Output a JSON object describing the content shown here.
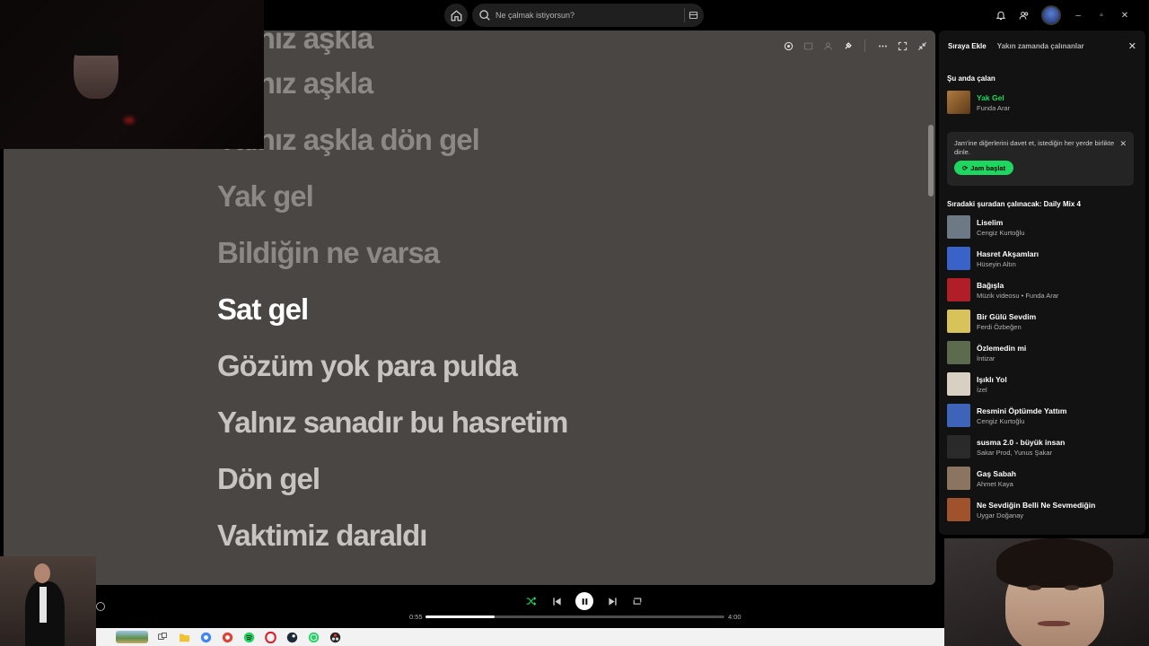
{
  "search": {
    "placeholder": "Ne çalmak istiyorsun?"
  },
  "queue": {
    "tabs": [
      "Sıraya Ekle",
      "Yakın zamanda çalınanlar"
    ],
    "now_playing_heading": "Şu anda çalan",
    "now_playing": {
      "title": "Yak Gel",
      "artist": "Funda Arar"
    },
    "jam": {
      "text": "Jam'ine diğerlerini davet et, istediğin her yerde birlikte dinle.",
      "button": "Jam başlat"
    },
    "next_heading": "Sıradaki şuradan çalınacak: Daily Mix 4",
    "items": [
      {
        "title": "Liselim",
        "artist": "Cengiz Kurtoğlu",
        "color": "#6d7a86"
      },
      {
        "title": "Hasret Akşamları",
        "artist": "Hüseyin Altın",
        "color": "#3a63c9"
      },
      {
        "title": "Bağışla",
        "artist": "Müzik videosu • Funda Arar",
        "color": "#b21e28"
      },
      {
        "title": "Bir Gülü Sevdim",
        "artist": "Ferdi Özbeğen",
        "color": "#d8c25a"
      },
      {
        "title": "Özlemedin mi",
        "artist": "İntizar",
        "color": "#5c6b4d"
      },
      {
        "title": "Işıklı Yol",
        "artist": "İzel",
        "color": "#d9d0c4"
      },
      {
        "title": "Resmini Öptümde Yattım",
        "artist": "Cengiz Kurtoğlu",
        "color": "#3d64b8"
      },
      {
        "title": "susma 2.0 - büyük insan",
        "artist": "Sakar Prod, Yunus Şakar",
        "color": "#2a2a2a"
      },
      {
        "title": "Gaş Sabah",
        "artist": "Ahmet Kaya",
        "color": "#8b7560"
      },
      {
        "title": "Ne Sevdiğin Belli Ne Sevmediğin",
        "artist": "Uygar Doğanay",
        "color": "#a0522d"
      }
    ]
  },
  "lyrics": {
    "past": [
      "Yalnız aşkla",
      "Yalnız aşkla dön gel",
      "Yak gel",
      "Bildiğin ne varsa"
    ],
    "current": "Sat gel",
    "future": [
      "Gözüm yok para pulda",
      "Yalnız sanadır bu hasretim",
      "Dön gel",
      "Vaktimiz daraldı"
    ]
  },
  "player": {
    "elapsed": "0:55",
    "duration": "4:00",
    "progress": 0.23
  },
  "colors": {
    "accent": "#1ed760",
    "lyrics_bg": "#4a4644"
  }
}
